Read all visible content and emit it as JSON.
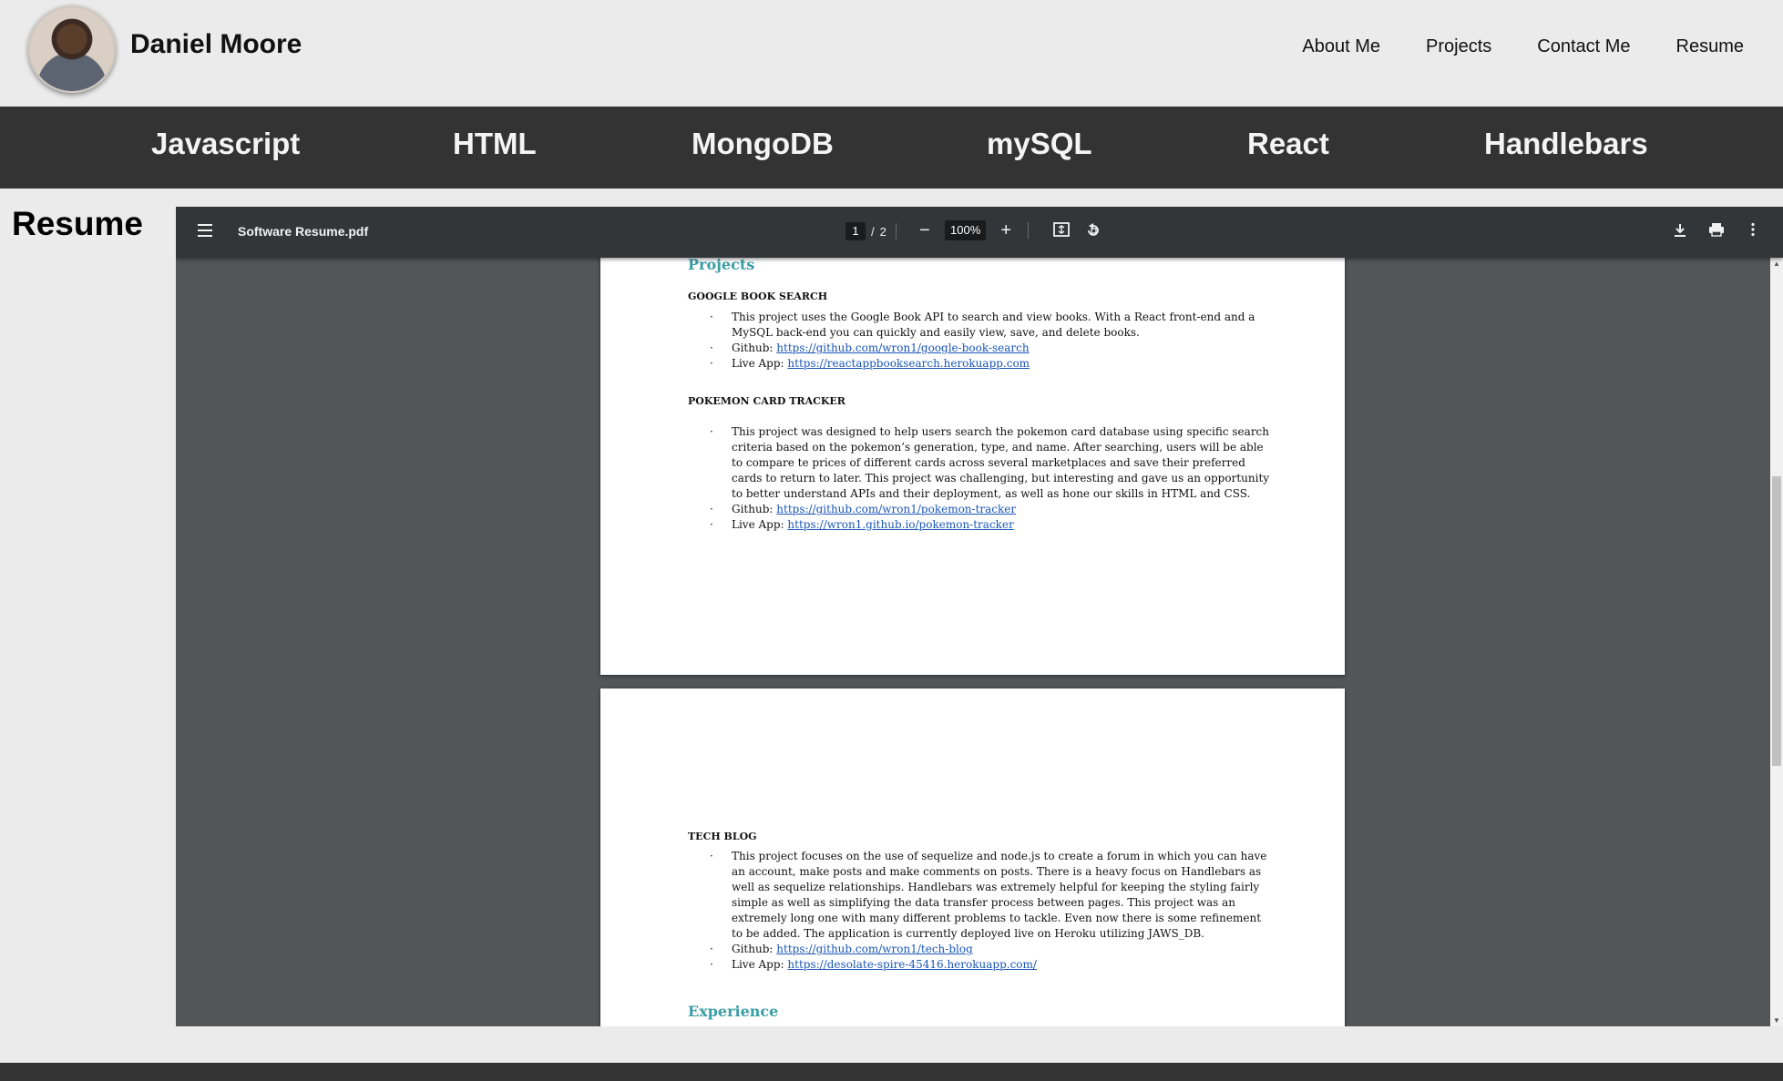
{
  "header": {
    "name": "Daniel Moore",
    "nav": [
      "About Me",
      "Projects",
      "Contact Me",
      "Resume"
    ]
  },
  "skills": [
    "Javascript",
    "HTML",
    "MongoDB",
    "mySQL",
    "React",
    "Handlebars"
  ],
  "resume_heading": "Resume",
  "pdf_viewer": {
    "file_name": "Software Resume.pdf",
    "current_page": "1",
    "page_separator": "/",
    "total_pages": "2",
    "zoom": "100%",
    "icons": [
      "menu-icon",
      "zoom-out-icon",
      "zoom-in-icon",
      "fit-page-icon",
      "rotate-icon",
      "download-icon",
      "print-icon",
      "more-icon"
    ]
  },
  "document": {
    "projects_heading": "Projects",
    "projects": [
      {
        "title": "GOOGLE BOOK SEARCH",
        "description": "This project uses the Google Book API to search and view books. With a React front-end and a MySQL back-end you can quickly and easily view, save, and delete books.",
        "github_label": "Github:",
        "github_url": "https://github.com/wron1/google-book-search",
        "live_label": "Live App:",
        "live_url": "https://reactappbooksearch.herokuapp.com"
      },
      {
        "title": "POKEMON CARD TRACKER",
        "description": "This project was designed to help users search the pokemon card database using specific search criteria based on the pokemon’s generation, type, and name. After searching, users will be able to compare te prices of different cards across several marketplaces and save their preferred cards to return to later. This project was challenging, but interesting and gave us an opportunity to better understand APIs and their deployment, as well as hone our skills in HTML and CSS.",
        "github_label": "Github:",
        "github_url": "https://github.com/wron1/pokemon-tracker",
        "live_label": "Live App:",
        "live_url": "https://wron1.github.io/pokemon-tracker"
      },
      {
        "title": "TECH BLOG",
        "description": "This project focuses on the use of sequelize and node.js to create a forum in which you can have an account, make posts and make comments on posts. There is a heavy focus on Handlebars as well as sequelize relationships. Handlebars was extremely helpful for keeping the styling fairly simple as well as simplifying the data transfer process between pages. This project was an extremely long one with many different problems to tackle. Even now there is some refinement to be added. The application is currently deployed live on Heroku utilizing JAWS_DB.",
        "github_label": "Github:",
        "github_url": "https://github.com/wron1/tech-blog",
        "live_label": "Live App:",
        "live_url": "https://desolate-spire-45416.herokuapp.com/"
      }
    ],
    "experience_heading": "Experience"
  }
}
